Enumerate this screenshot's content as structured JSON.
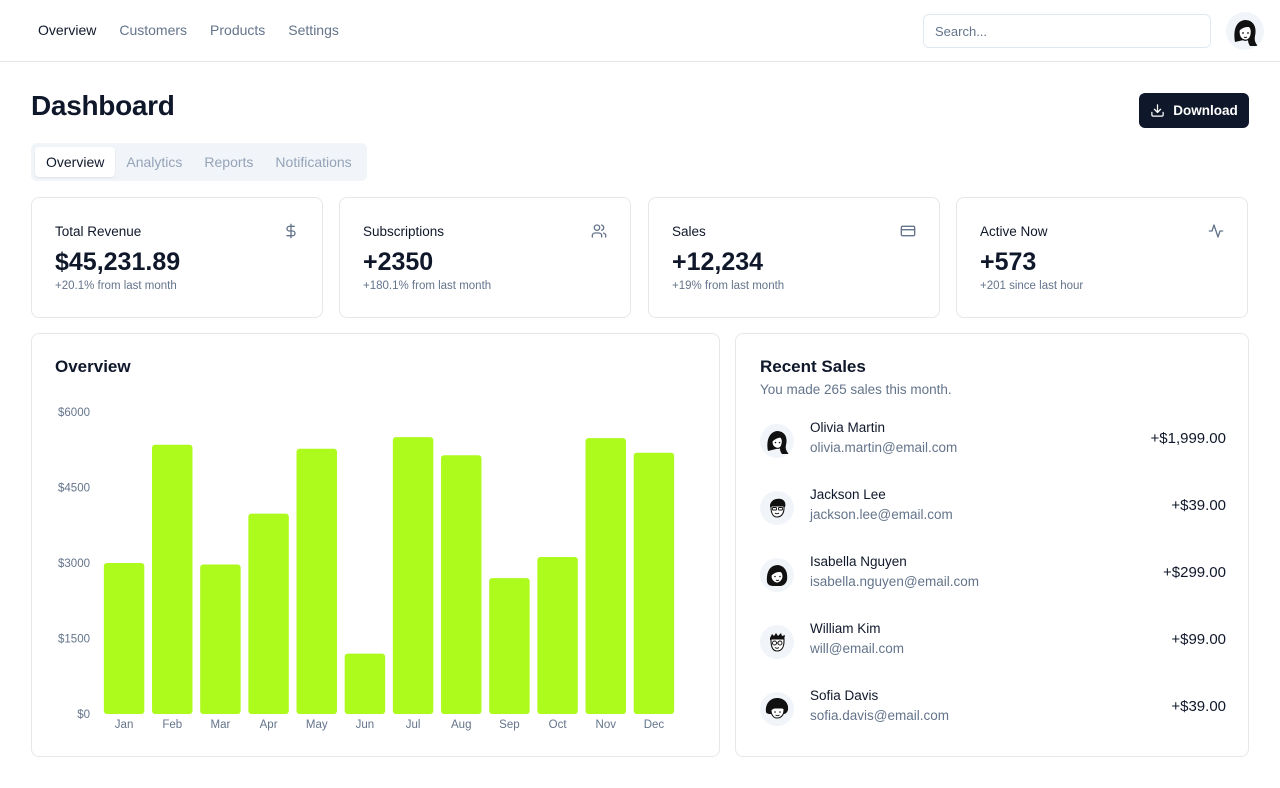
{
  "nav": {
    "items": [
      {
        "label": "Overview",
        "active": true
      },
      {
        "label": "Customers",
        "active": false
      },
      {
        "label": "Products",
        "active": false
      },
      {
        "label": "Settings",
        "active": false
      }
    ],
    "search_placeholder": "Search...",
    "avatar_icon": "user-avatar-icon"
  },
  "header": {
    "title": "Dashboard",
    "download_label": "Download",
    "download_icon": "download-icon"
  },
  "tabs": [
    {
      "label": "Overview",
      "active": true
    },
    {
      "label": "Analytics",
      "active": false
    },
    {
      "label": "Reports",
      "active": false
    },
    {
      "label": "Notifications",
      "active": false
    }
  ],
  "stats": [
    {
      "label": "Total Revenue",
      "value": "$45,231.89",
      "sub": "+20.1% from last month",
      "icon": "dollar-icon"
    },
    {
      "label": "Subscriptions",
      "value": "+2350",
      "sub": "+180.1% from last month",
      "icon": "users-icon"
    },
    {
      "label": "Sales",
      "value": "+12,234",
      "sub": "+19% from last month",
      "icon": "credit-card-icon"
    },
    {
      "label": "Active Now",
      "value": "+573",
      "sub": "+201 since last hour",
      "icon": "activity-icon"
    }
  ],
  "overview": {
    "title": "Overview"
  },
  "chart_data": {
    "type": "bar",
    "title": "Overview",
    "categories": [
      "Jan",
      "Feb",
      "Mar",
      "Apr",
      "May",
      "Jun",
      "Jul",
      "Aug",
      "Sep",
      "Oct",
      "Nov",
      "Dec"
    ],
    "values": [
      3000,
      5350,
      2970,
      3980,
      5270,
      1200,
      5500,
      5140,
      2700,
      3120,
      5480,
      5190
    ],
    "yticks": [
      "$0",
      "$1500",
      "$3000",
      "$4500",
      "$6000"
    ],
    "ylim": [
      0,
      6000
    ],
    "xlabel": "",
    "ylabel": "",
    "grid": false,
    "bar_color": "#adfa1d"
  },
  "recent_sales": {
    "title": "Recent Sales",
    "subtitle": "You made 265 sales this month.",
    "items": [
      {
        "name": "Olivia Martin",
        "email": "olivia.martin@email.com",
        "amount": "+$1,999.00",
        "avatar": "avatar-olivia-icon"
      },
      {
        "name": "Jackson Lee",
        "email": "jackson.lee@email.com",
        "amount": "+$39.00",
        "avatar": "avatar-jackson-icon"
      },
      {
        "name": "Isabella Nguyen",
        "email": "isabella.nguyen@email.com",
        "amount": "+$299.00",
        "avatar": "avatar-isabella-icon"
      },
      {
        "name": "William Kim",
        "email": "will@email.com",
        "amount": "+$99.00",
        "avatar": "avatar-william-icon"
      },
      {
        "name": "Sofia Davis",
        "email": "sofia.davis@email.com",
        "amount": "+$39.00",
        "avatar": "avatar-sofia-icon"
      }
    ]
  },
  "colors": {
    "accent": "#adfa1d",
    "primary": "#0f172a",
    "muted": "#64748b",
    "border": "#e5e7eb"
  }
}
